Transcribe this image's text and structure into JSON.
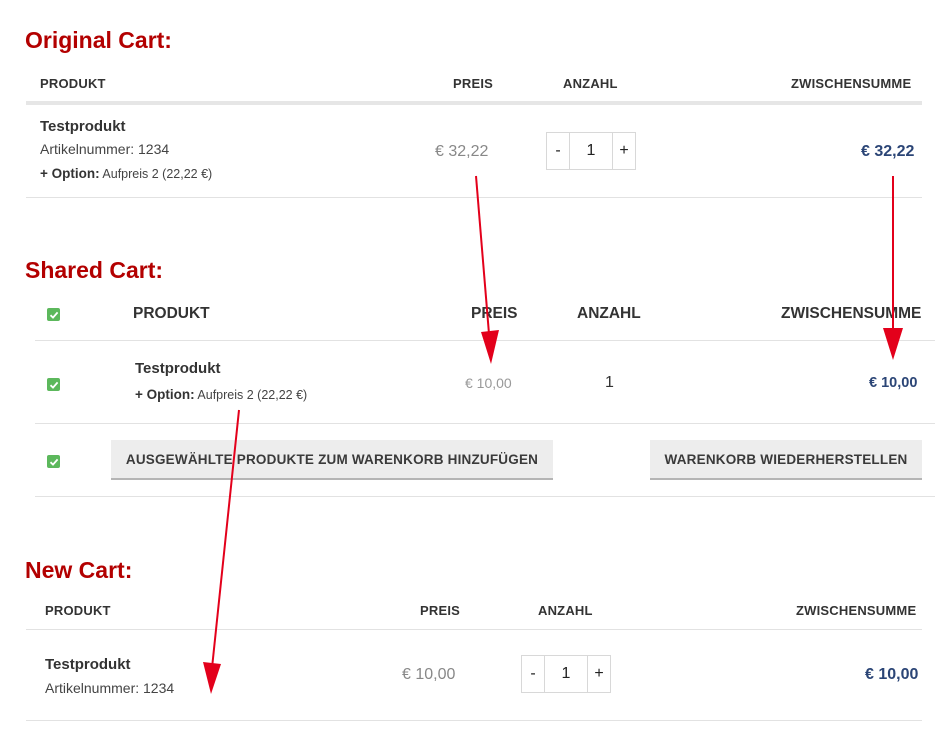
{
  "original": {
    "title": "Original Cart:",
    "headers": {
      "product": "PRODUKT",
      "price": "PREIS",
      "quantity": "ANZAHL",
      "subtotal": "ZWISCHENSUMME"
    },
    "item": {
      "name": "Testprodukt",
      "sku": "Artikelnummer: 1234",
      "option_label": "+ Option:",
      "option_value": "Aufpreis 2 (22,22 €)",
      "price": "€ 32,22",
      "qty_minus": "-",
      "qty": "1",
      "qty_plus": "+",
      "subtotal": "€ 32,22"
    }
  },
  "shared": {
    "title": "Shared Cart:",
    "headers": {
      "product": "PRODUKT",
      "price": "PREIS",
      "quantity": "ANZAHL",
      "subtotal": "ZWISCHENSUMME"
    },
    "item": {
      "name": "Testprodukt",
      "option_label": "+ Option:",
      "option_value": "Aufpreis 2 (22,22 €)",
      "price": "€ 10,00",
      "qty": "1",
      "subtotal": "€ 10,00"
    },
    "buttons": {
      "add_selected": "AUSGEWÄHLTE PRODUKTE ZUM WARENKORB HINZUFÜGEN",
      "restore": "WARENKORB WIEDERHERSTELLEN"
    },
    "checkbox_color": "#5cb85c"
  },
  "new_cart": {
    "title": "New Cart:",
    "headers": {
      "product": "PRODUKT",
      "price": "PREIS",
      "quantity": "ANZAHL",
      "subtotal": "ZWISCHENSUMME"
    },
    "item": {
      "name": "Testprodukt",
      "sku": "Artikelnummer: 1234",
      "price": "€ 10,00",
      "qty_minus": "-",
      "qty": "1",
      "qty_plus": "+",
      "subtotal": "€ 10,00"
    }
  },
  "colors": {
    "title_red": "#b30000",
    "subtotal_blue": "#2b4576",
    "arrow_red": "#e3001b"
  }
}
